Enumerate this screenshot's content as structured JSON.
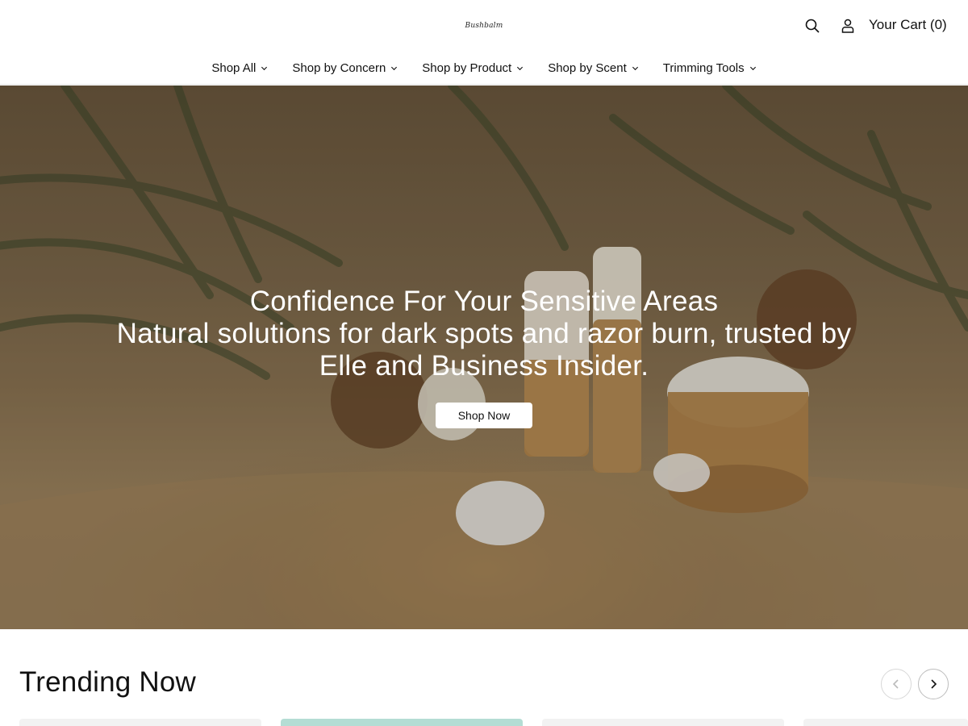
{
  "header": {
    "logo_text": "Bushbalm",
    "cart_label": "Your Cart (0)"
  },
  "nav": {
    "items": [
      {
        "label": "Shop All"
      },
      {
        "label": "Shop by Concern"
      },
      {
        "label": "Shop by Product"
      },
      {
        "label": "Shop by Scent"
      },
      {
        "label": "Trimming Tools"
      }
    ]
  },
  "hero": {
    "title": "Confidence For Your Sensitive Areas",
    "subtitle": "Natural solutions for dark spots and razor burn, trusted by Elle and Business Insider.",
    "cta_label": "Shop Now"
  },
  "trending": {
    "title": "Trending Now"
  },
  "icons": {
    "search": "search-icon",
    "account": "user-icon",
    "nav_dropdown": "chevron-down-icon",
    "prev": "chevron-left-icon",
    "next": "chevron-right-icon"
  },
  "colors": {
    "accent_card": "#b4ddd4",
    "text": "#111111",
    "background": "#ffffff"
  }
}
